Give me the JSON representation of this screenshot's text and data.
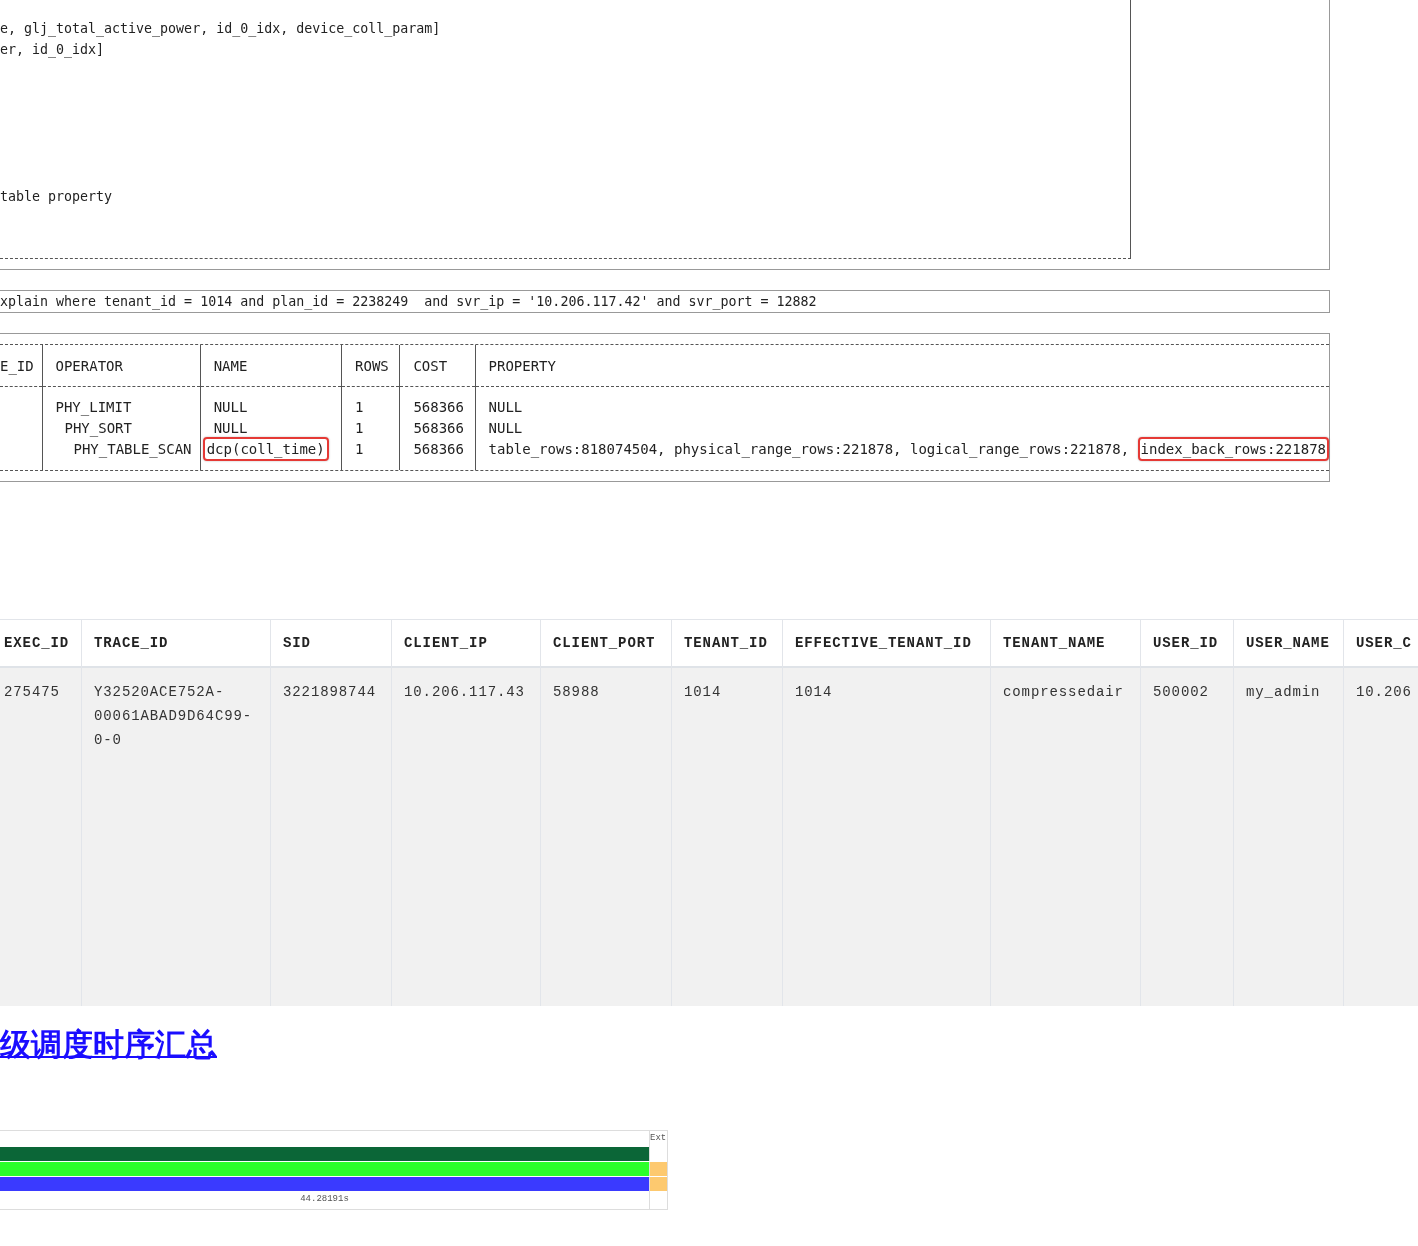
{
  "output_panel": {
    "lines": [
      "e, glj_total_active_power, id_0_idx, device_coll_param]",
      "er, id_0_idx]",
      "table property"
    ]
  },
  "query": "xplain where tenant_id = 1014 and plan_id = 2238249  and svr_ip = '10.206.117.42' and svr_port = 12882",
  "plan_table": {
    "columns": [
      "E_ID",
      "OPERATOR",
      "NAME",
      "ROWS",
      "COST",
      "PROPERTY"
    ],
    "rows": [
      {
        "operator": "PHY_LIMIT",
        "name": "NULL",
        "name_highlighted": false,
        "rows": "1",
        "cost": "568366",
        "property": [
          {
            "text": "NULL",
            "highlighted": false
          }
        ],
        "children": [
          {
            "operator": "PHY_SORT",
            "name": "NULL",
            "name_highlighted": false,
            "rows": "1",
            "cost": "568366",
            "property": [
              {
                "text": "NULL",
                "highlighted": false
              }
            ],
            "children": [
              {
                "operator": "PHY_TABLE_SCAN",
                "name": "dcp(coll_time)",
                "name_highlighted": true,
                "rows": "1",
                "cost": "568366",
                "property": [
                  {
                    "text": "table_rows:818074504, physical_range_rows:221878, logical_range_rows:221878,",
                    "highlighted": false
                  },
                  {
                    "text": "index_back_rows:221878",
                    "highlighted": true
                  }
                ]
              }
            ]
          }
        ]
      }
    ]
  },
  "data_table": {
    "columns": [
      "EXEC_ID",
      "TRACE_ID",
      "SID",
      "CLIENT_IP",
      "CLIENT_PORT",
      "TENANT_ID",
      "EFFECTIVE_TENANT_ID",
      "TENANT_NAME",
      "USER_ID",
      "USER_NAME",
      "USER_C"
    ],
    "rows": [
      [
        "275475",
        "Y32520ACE752A-00061ABAD9D64C99-0-0",
        "3221898744",
        "10.206.117.43",
        "58988",
        "1014",
        "1014",
        "compressedair",
        "500002",
        "my_admin",
        "10.206"
      ]
    ]
  },
  "section_link": "级调度时序汇总",
  "timeline": {
    "ext_label": "Ext",
    "duration_label": "44.28191s",
    "bars": [
      {
        "color": "#0b6637",
        "ext_marked": false
      },
      {
        "color": "#2bff2b",
        "ext_marked": true
      },
      {
        "color": "#3a3aff",
        "ext_marked": true
      }
    ]
  }
}
